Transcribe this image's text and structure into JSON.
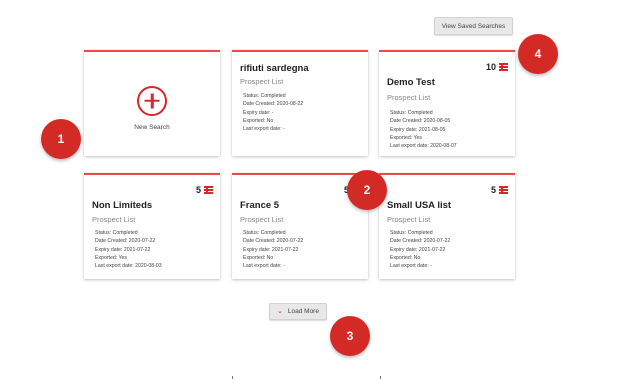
{
  "toolbar": {
    "view_saved_label": "View Saved Searches"
  },
  "new_search": {
    "label": "New Search"
  },
  "cards": [
    {
      "title": "rifiuti sardegna",
      "subtitle": "Prospect List",
      "count": "",
      "status": "Status: Completed",
      "created": "Date Created: 2020-08-22",
      "expiry": "Expiry date: -",
      "exported": "Exported: No",
      "last_export": "Last export date: -"
    },
    {
      "title": "Demo Test",
      "subtitle": "Prospect List",
      "count": "10",
      "status": "Status: Completed",
      "created": "Date Created: 2020-08-05",
      "expiry": "Expiry date: 2021-08-05",
      "exported": "Exported: Yes",
      "last_export": "Last export date: 2020-08-07"
    },
    {
      "title": "Non Limiteds",
      "subtitle": "Prospect List",
      "count": "5",
      "status": "Status: Completed",
      "created": "Date Created: 2020-07-22",
      "expiry": "Expiry date: 2021-07-22",
      "exported": "Exported: Yes",
      "last_export": "Last export date: 2020-08-03"
    },
    {
      "title": "France 5",
      "subtitle": "Prospect List",
      "count": "5",
      "status": "Status: Completed",
      "created": "Date Created: 2020-07-22",
      "expiry": "Expiry date: 2021-07-22",
      "exported": "Exported: No",
      "last_export": "Last export date: -"
    },
    {
      "title": "Small USA list",
      "subtitle": "Prospect List",
      "count": "5",
      "status": "Status: Completed",
      "created": "Date Created: 2020-07-22",
      "expiry": "Expiry date: 2021-07-22",
      "exported": "Exported: No",
      "last_export": "Last export date: -"
    }
  ],
  "load_more": {
    "label": "Load More",
    "icon": "chevron-down-icon"
  },
  "markers": [
    "1",
    "2",
    "3",
    "4"
  ],
  "colors": {
    "accent": "#d9262c",
    "marker": "#d42a26",
    "card_border": "#e94b4b"
  }
}
